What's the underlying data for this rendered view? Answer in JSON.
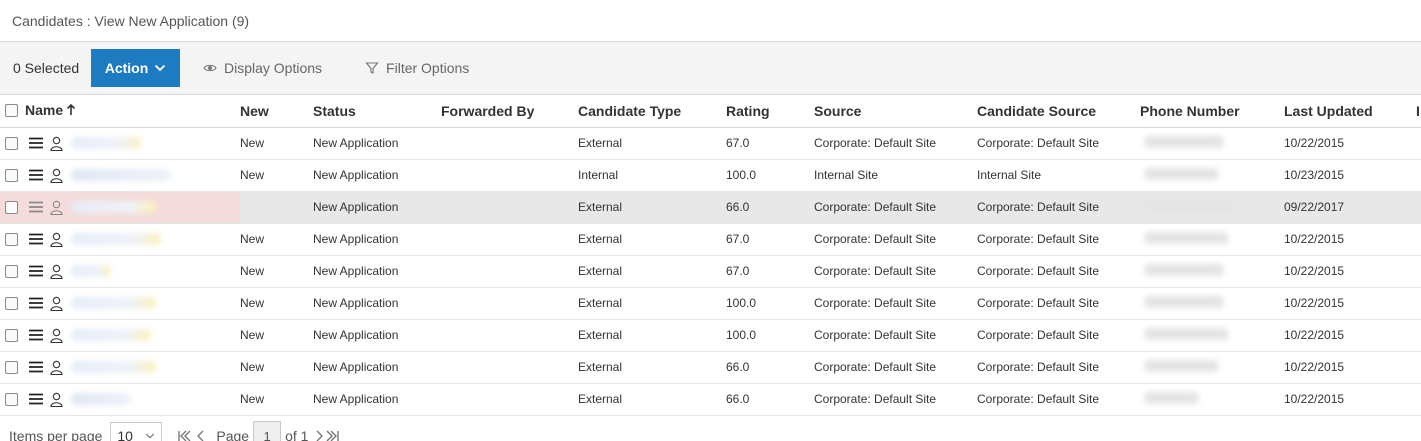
{
  "header": {
    "breadcrumb": "Candidates : View New Application (9)"
  },
  "toolbar": {
    "selected_label": "0 Selected",
    "action_label": "Action",
    "display_options_label": "Display Options",
    "filter_options_label": "Filter Options"
  },
  "table": {
    "columns": [
      "Name",
      "New",
      "Status",
      "Forwarded By",
      "Candidate Type",
      "Rating",
      "Source",
      "Candidate Source",
      "Phone Number",
      "Last Updated",
      "I"
    ],
    "rows": [
      {
        "new": "New",
        "status": "New Application",
        "forwarded_by": "",
        "candidate_type": "External",
        "rating": "67.0",
        "source": "Corporate: Default Site",
        "candidate_source": "Corporate: Default Site",
        "last_updated": "10/22/2015"
      },
      {
        "new": "New",
        "status": "New Application",
        "forwarded_by": "",
        "candidate_type": "Internal",
        "rating": "100.0",
        "source": "Internal Site",
        "candidate_source": "Internal Site",
        "last_updated": "10/23/2015"
      },
      {
        "new": "",
        "status": "New Application",
        "forwarded_by": "",
        "candidate_type": "External",
        "rating": "66.0",
        "source": "Corporate: Default Site",
        "candidate_source": "Corporate: Default Site",
        "last_updated": "09/22/2017"
      },
      {
        "new": "New",
        "status": "New Application",
        "forwarded_by": "",
        "candidate_type": "External",
        "rating": "67.0",
        "source": "Corporate: Default Site",
        "candidate_source": "Corporate: Default Site",
        "last_updated": "10/22/2015"
      },
      {
        "new": "New",
        "status": "New Application",
        "forwarded_by": "",
        "candidate_type": "External",
        "rating": "67.0",
        "source": "Corporate: Default Site",
        "candidate_source": "Corporate: Default Site",
        "last_updated": "10/22/2015"
      },
      {
        "new": "New",
        "status": "New Application",
        "forwarded_by": "",
        "candidate_type": "External",
        "rating": "100.0",
        "source": "Corporate: Default Site",
        "candidate_source": "Corporate: Default Site",
        "last_updated": "10/22/2015"
      },
      {
        "new": "New",
        "status": "New Application",
        "forwarded_by": "",
        "candidate_type": "External",
        "rating": "100.0",
        "source": "Corporate: Default Site",
        "candidate_source": "Corporate: Default Site",
        "last_updated": "10/22/2015"
      },
      {
        "new": "New",
        "status": "New Application",
        "forwarded_by": "",
        "candidate_type": "External",
        "rating": "66.0",
        "source": "Corporate: Default Site",
        "candidate_source": "Corporate: Default Site",
        "last_updated": "10/22/2015"
      },
      {
        "new": "New",
        "status": "New Application",
        "forwarded_by": "",
        "candidate_type": "External",
        "rating": "66.0",
        "source": "Corporate: Default Site",
        "candidate_source": "Corporate: Default Site",
        "last_updated": "10/22/2015"
      }
    ]
  },
  "pagination": {
    "items_per_page_label": "Items per page",
    "items_per_page_value": "10",
    "page_label": "Page",
    "page_value": "1",
    "of_label": "of 1"
  },
  "colors": {
    "action_button": "#1c7bc1",
    "highlight_row": "#e8e8e8"
  }
}
